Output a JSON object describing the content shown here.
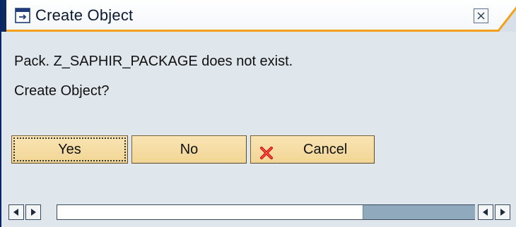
{
  "dialog": {
    "title": "Create Object",
    "message_line1": "Pack. Z_SAPHIR_PACKAGE does not exist.",
    "message_line2": "Create Object?",
    "close_icon": "close-x-icon"
  },
  "buttons": {
    "yes_label": "Yes",
    "no_label": "No",
    "cancel_label": "Cancel",
    "cancel_icon": "red-x-icon"
  },
  "scrollbar": {
    "left_arrow_icon": "arrow-left-icon",
    "right_arrow_icon": "arrow-right-icon"
  },
  "colors": {
    "title_underline": "#f4a01a",
    "button_fill": "#f2d595",
    "window_bg": "#dfe6ec",
    "accent_dark": "#0d2a5e"
  }
}
